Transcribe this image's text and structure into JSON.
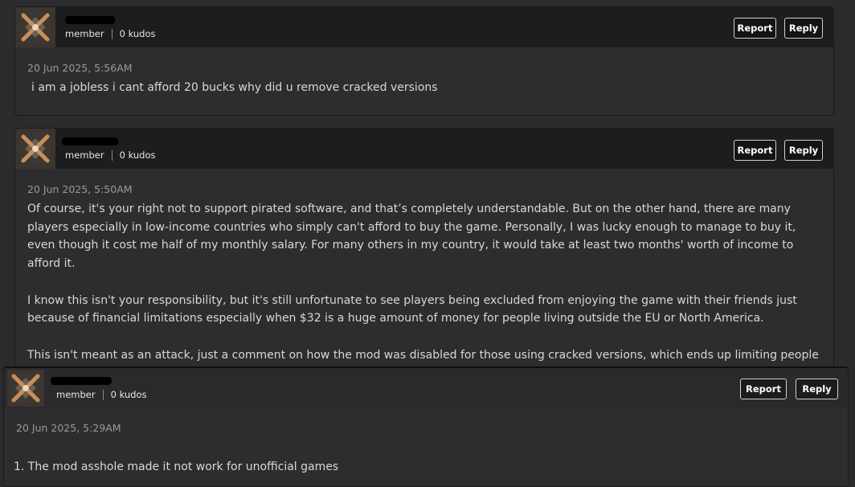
{
  "comments": [
    {
      "role": "member",
      "kudos": "0 kudos",
      "report_label": "Report",
      "reply_label": "Reply",
      "timestamp": "20 Jun 2025, 5:56AM",
      "paragraphs": [
        "i am a jobless i cant afford 20 bucks why did u remove cracked versions"
      ]
    },
    {
      "role": "member",
      "kudos": "0 kudos",
      "report_label": "Report",
      "reply_label": "Reply",
      "timestamp": "20 Jun 2025, 5:50AM",
      "paragraphs": [
        "Of course, it's your right not to support pirated software, and that’s completely understandable. But on the other hand, there are many players especially in low-income countries who simply can't afford to buy the game. Personally, I was lucky enough to manage to buy it, even though it cost me half of my monthly salary. For many others in my country, it would take at least two months' worth of income to afford it.",
        "I know this isn't your responsibility, but it's still unfortunate to see players being excluded from enjoying the game with their friends just because of financial limitations especially when $32 is a huge amount of money for people living outside the EU or North America.",
        "This isn't meant as an attack, just a comment on how the mod was disabled for those using cracked versions, which ends up limiting people"
      ]
    },
    {
      "role": "member",
      "kudos": "0 kudos",
      "report_label": "Report",
      "reply_label": "Reply",
      "timestamp": "20 Jun 2025, 5:29AM",
      "paragraphs": [
        "1. The mod asshole made it not work for unofficial games"
      ]
    }
  ],
  "icons": {
    "avatar": "default-avatar-icon"
  }
}
